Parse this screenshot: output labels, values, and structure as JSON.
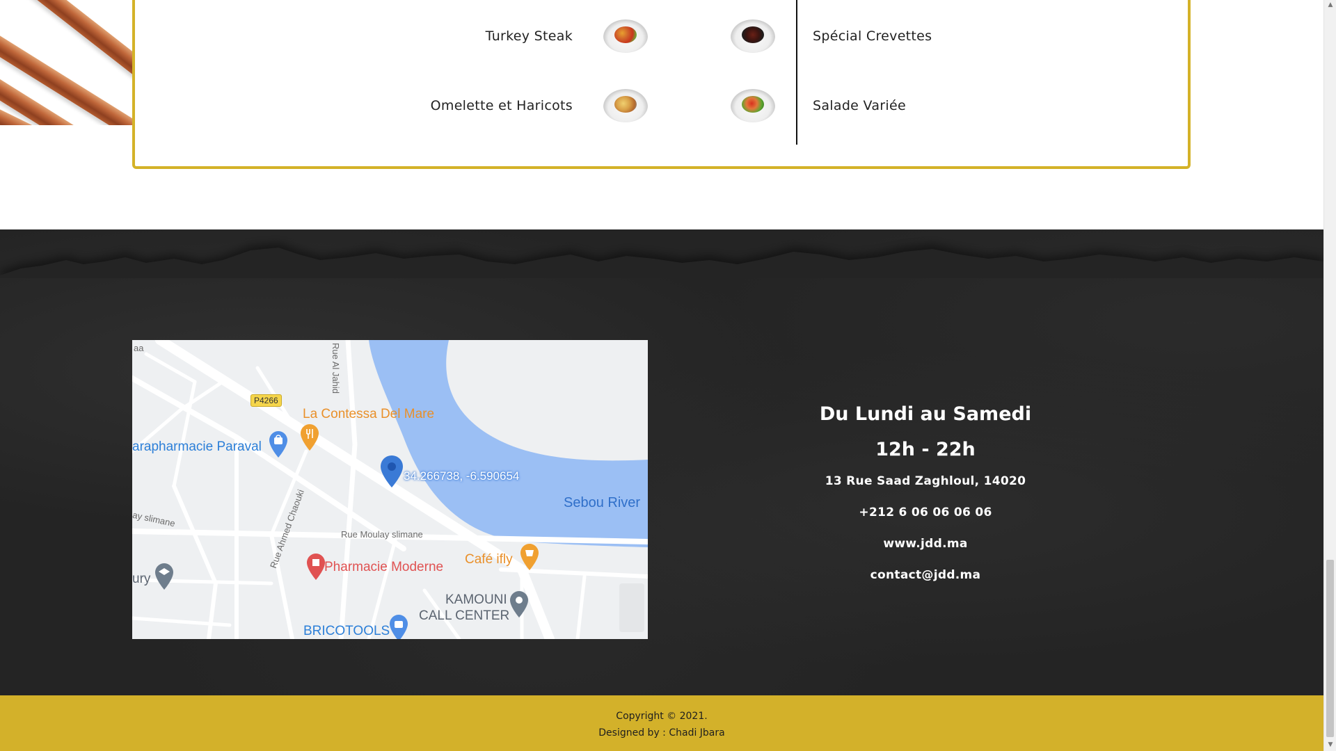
{
  "menu": {
    "left_items": [
      {
        "name": "Turkey Steak",
        "image": "turkey-steak-plate"
      },
      {
        "name": "Omelette et Haricots",
        "image": "omelette-beans-plate"
      }
    ],
    "right_items": [
      {
        "name": "Spécial Crevettes",
        "image": "shrimp-plate"
      },
      {
        "name": "Salade Variée",
        "image": "mixed-salad-plate"
      }
    ]
  },
  "map": {
    "labels": {
      "road_badge": "P4266",
      "restaurant": "La Contessa Del Mare",
      "parapharmacie": "arapharmacie Paraval",
      "coordinates": "34.266738, -6.590654",
      "river": "Sebou River",
      "road_slimane_left": "ay slimane",
      "road_moulay": "Rue Moulay slimane",
      "road_al_jahid": "Rue Al Jahid",
      "road_chaouki": "Rue Ahmed Chaouki",
      "pharmacie": "Pharmacie Moderne",
      "cafe": "Café ifly",
      "school": "ury",
      "call_center_line1": "KAMOUNI",
      "call_center_line2": "CALL CENTER",
      "bricotools": "BRICOTOOLS",
      "corner": "aa"
    },
    "colors": {
      "river": "#9bbff4",
      "land": "#eef0f2",
      "road": "#ffffff",
      "pin": "#3a7ad6"
    }
  },
  "info": {
    "days": "Du Lundi au Samedi",
    "hours": "12h - 22h",
    "address": "13 Rue Saad Zaghloul, 14020",
    "phone": "+212 6 06 06 06 06",
    "website": "www.jdd.ma",
    "email": "contact@jdd.ma"
  },
  "footer": {
    "copyright": "Copyright © 2021.",
    "designed_by": "Designed by : Chadi Jbara"
  },
  "theme": {
    "gold": "#d3b12a",
    "dark": "#242424"
  }
}
